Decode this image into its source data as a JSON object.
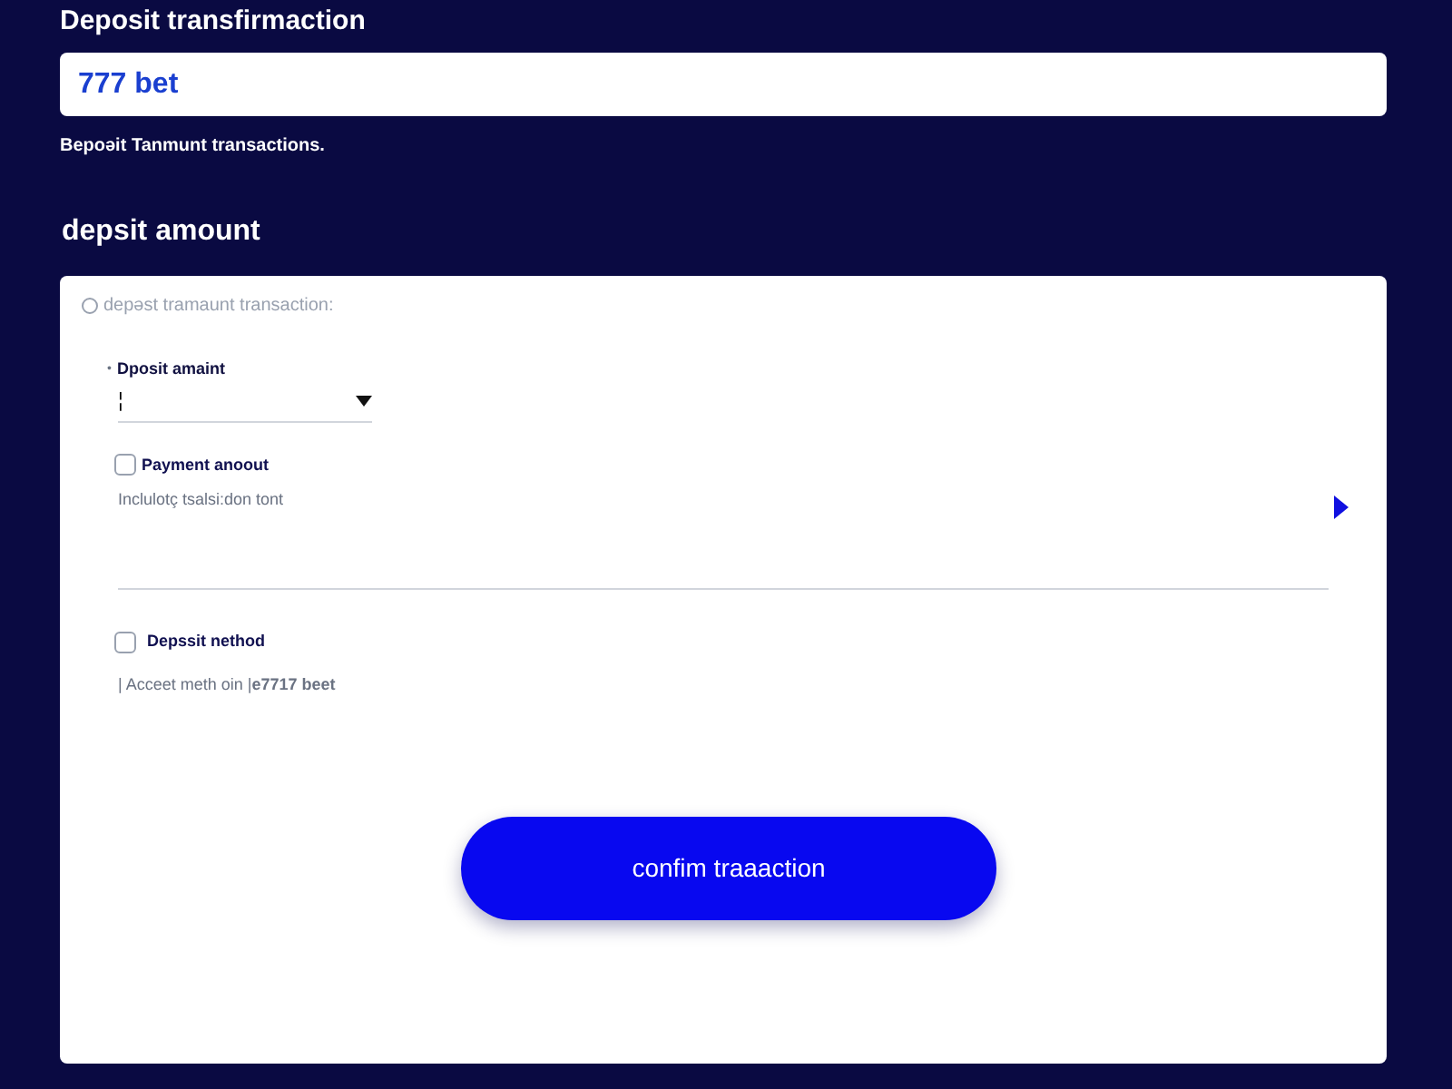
{
  "title": "Deposit transfirmaction",
  "search": {
    "value": "777 bet"
  },
  "helper": "Bepoəit Tanmunt transactions.",
  "section_title": "depsit amount",
  "card": {
    "header": "depəst tramaunt transaction:",
    "select": {
      "label": "Dposit amaint",
      "bullet": "•",
      "value": "¦"
    },
    "payment": {
      "label": "Payment anoout",
      "checked": false,
      "text": "Inclulotç tsalsi:don tont"
    },
    "method": {
      "label": "Depssit nethod",
      "checked": false,
      "text": "| Acceet meth oin |**e7717 beet**"
    },
    "button": "confim traaaction"
  }
}
